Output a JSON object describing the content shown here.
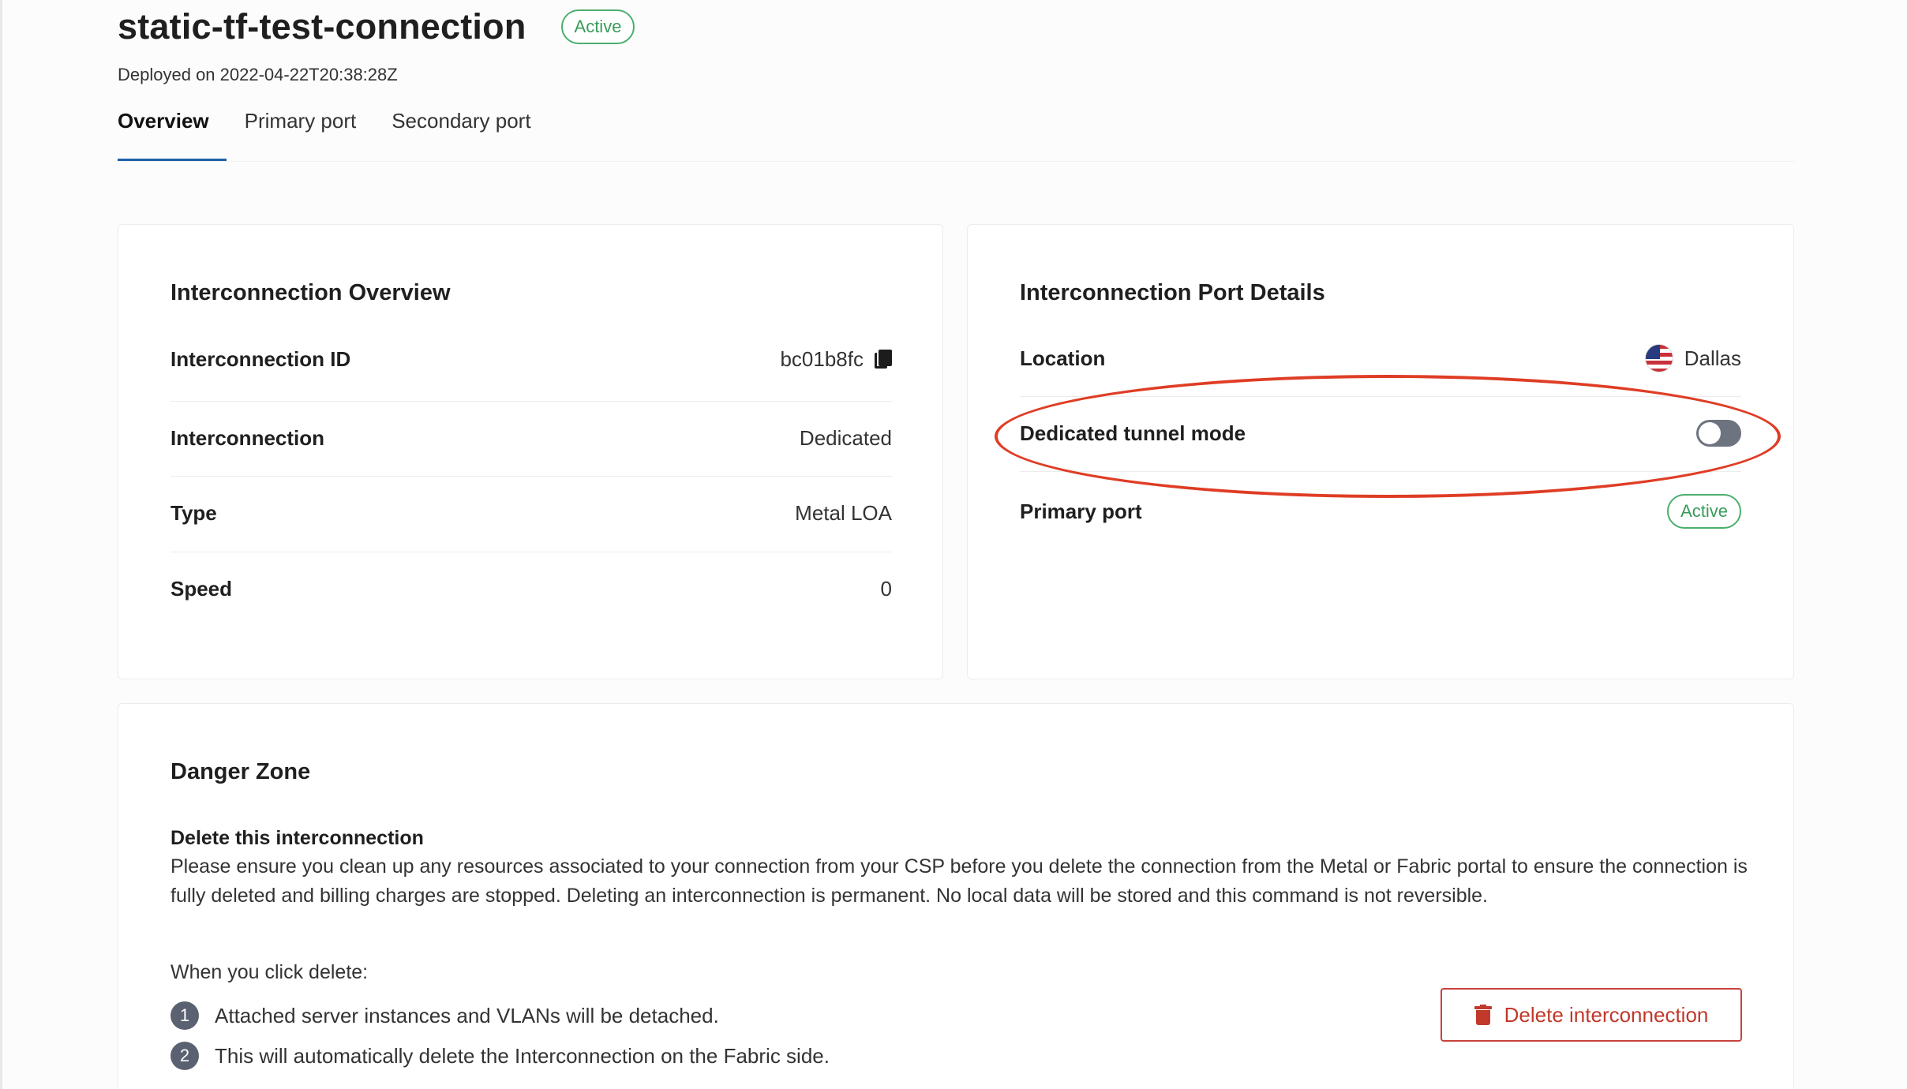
{
  "header": {
    "title": "static-tf-test-connection",
    "status": "Active",
    "deployed": "Deployed on 2022-04-22T20:38:28Z"
  },
  "tabs": [
    {
      "label": "Overview",
      "active": true
    },
    {
      "label": "Primary port",
      "active": false
    },
    {
      "label": "Secondary port",
      "active": false
    }
  ],
  "overview": {
    "title": "Interconnection Overview",
    "rows": [
      {
        "label": "Interconnection ID",
        "value": "bc01b8fc"
      },
      {
        "label": "Interconnection",
        "value": "Dedicated"
      },
      {
        "label": "Type",
        "value": "Metal LOA"
      },
      {
        "label": "Speed",
        "value": "0"
      }
    ]
  },
  "port_details": {
    "title": "Interconnection Port Details",
    "location_label": "Location",
    "location_value": "Dallas",
    "tunnel_label": "Dedicated tunnel mode",
    "tunnel_enabled": false,
    "primary_port_label": "Primary port",
    "primary_port_status": "Active"
  },
  "danger": {
    "title": "Danger Zone",
    "delete_heading": "Delete this interconnection",
    "delete_description": "Please ensure you clean up any resources associated to your connection from your CSP before you delete the connection from the Metal or Fabric portal to ensure the connection is fully deleted and billing charges are stopped. Deleting an interconnection is permanent. No local data will be stored and this command is not reversible.",
    "when_text": "When you click delete:",
    "steps": [
      {
        "num": "1",
        "text": "Attached server instances and VLANs will be detached."
      },
      {
        "num": "2",
        "text": "This will automatically delete the Interconnection on the Fabric side."
      }
    ],
    "delete_button": "Delete interconnection"
  },
  "colors": {
    "accent": "#1f5fa8",
    "active_green": "#3a9b5b",
    "danger_red": "#c0392b",
    "annotation_red": "#df3d25"
  }
}
